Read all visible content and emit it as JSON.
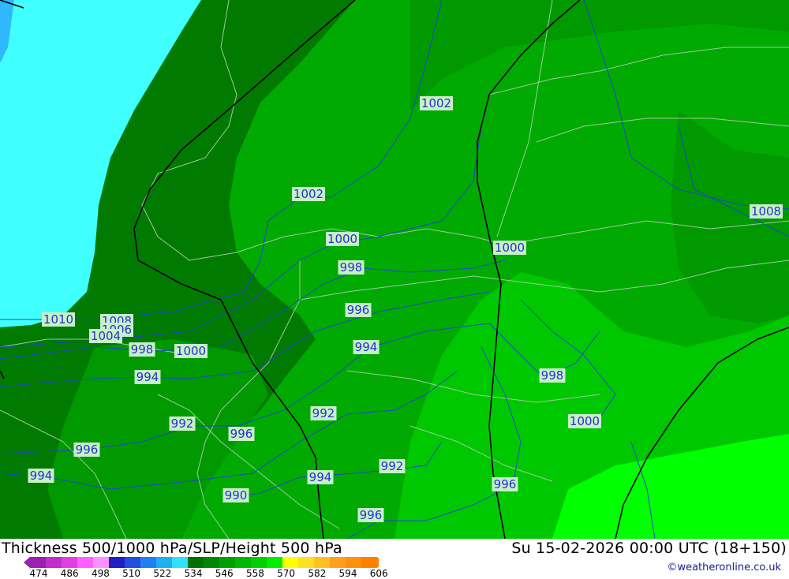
{
  "title": {
    "left": "Thickness 500/1000 hPa/SLP/Height 500 hPa",
    "right": "Su 15-02-2026 00:00 UTC (18+150)"
  },
  "credit": "©weatheronline.co.uk",
  "colorbar": {
    "ticks": [
      "474",
      "486",
      "498",
      "510",
      "522",
      "534",
      "546",
      "558",
      "570",
      "582",
      "594",
      "606"
    ],
    "colors": [
      "#9a20b0",
      "#c030c8",
      "#e040e0",
      "#ff60ff",
      "#ff90ff",
      "#2020c0",
      "#2050e0",
      "#2080f0",
      "#20b0f0",
      "#30e0ff",
      "#007000",
      "#008800",
      "#00a000",
      "#00b800",
      "#00d000",
      "#00ee00",
      "#ffff00",
      "#ffe020",
      "#ffc020",
      "#ffa020",
      "#ff9010",
      "#ff8000"
    ]
  },
  "map": {
    "fill_colors": {
      "cyan": "#40ffff",
      "dark_green": "#007a00",
      "mid_green": "#009900",
      "green": "#00aa00",
      "bright_green": "#00c800",
      "lime": "#00ff00"
    },
    "isobar_color": "#2244cc",
    "isobar_labels": [
      "1002",
      "1002",
      "1008",
      "1000",
      "1000",
      "998",
      "996",
      "1010",
      "1008",
      "1006",
      "1004",
      "998",
      "1000",
      "994",
      "994",
      "998",
      "992",
      "1000",
      "992",
      "996",
      "996",
      "994",
      "994",
      "992",
      "990",
      "996",
      "996"
    ]
  }
}
